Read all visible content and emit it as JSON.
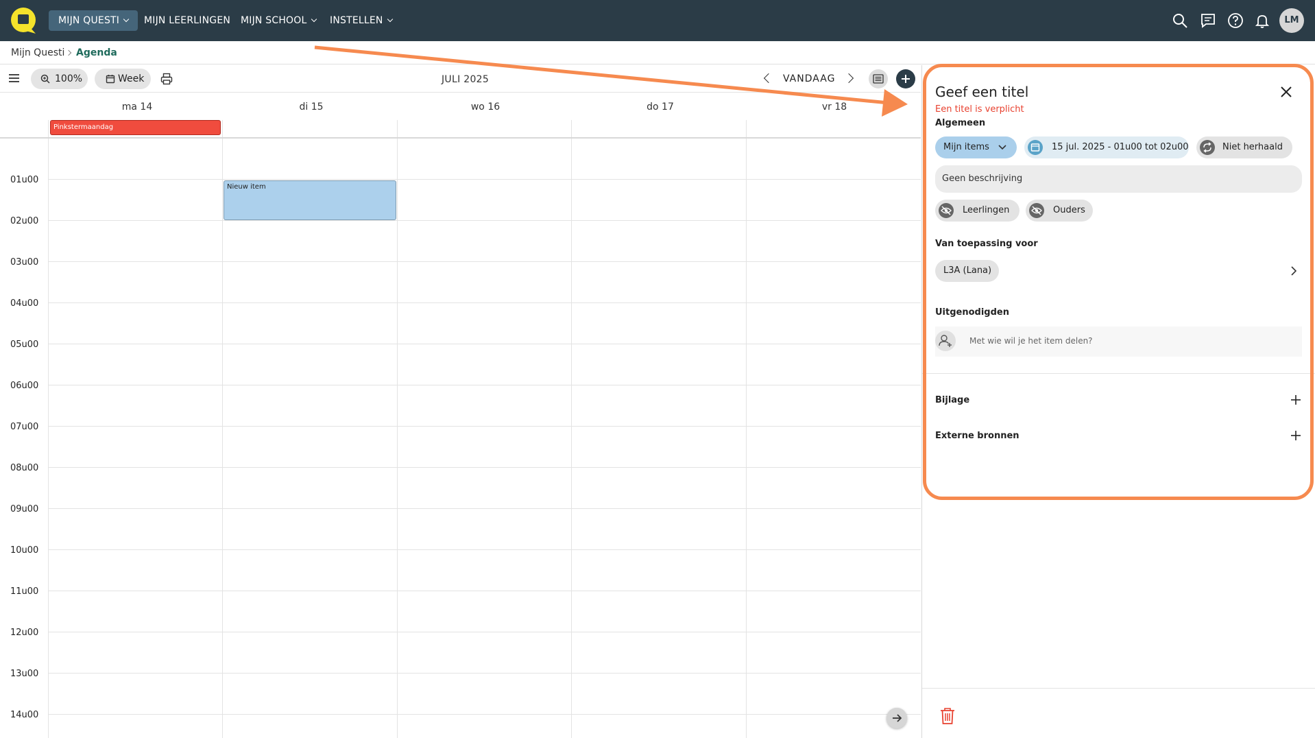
{
  "app": {
    "logo_icon": "questi-chat-logo-icon",
    "brand_color": "#f5e32b",
    "topbar_color": "#2b3c47"
  },
  "nav": {
    "items": [
      {
        "label": "MIJN QUESTI",
        "active": true,
        "dropdown": true
      },
      {
        "label": "MIJN LEERLINGEN",
        "active": false,
        "dropdown": false
      },
      {
        "label": "MIJN SCHOOL",
        "active": false,
        "dropdown": true
      },
      {
        "label": "INSTELLEN",
        "active": false,
        "dropdown": true
      }
    ],
    "icons": [
      "search-icon",
      "message-icon",
      "help-icon",
      "bell-icon"
    ],
    "avatar_initials": "LM"
  },
  "breadcrumb": {
    "home": "Mijn Questi",
    "current": "Agenda"
  },
  "toolbar": {
    "zoom": "100%",
    "view": "Week",
    "month": "JULI 2025",
    "today": "VANDAAG"
  },
  "calendar": {
    "days": [
      "ma 14",
      "di 15",
      "wo 16",
      "do 17",
      "vr 18"
    ],
    "holiday": "Pinkstermaandag",
    "hours": [
      "01u00",
      "02u00",
      "03u00",
      "04u00",
      "05u00",
      "06u00",
      "07u00",
      "08u00",
      "09u00",
      "10u00",
      "11u00",
      "12u00",
      "13u00",
      "14u00"
    ],
    "event": {
      "title": "Nieuw item",
      "color": "#acd0ec"
    },
    "holiday_color": "#f04c3e"
  },
  "panel": {
    "title": "Geef een titel",
    "error": "Een titel is verplicht",
    "error_color": "#e8412f",
    "section_general": "Algemeen",
    "calendar_chip": "Mijn items",
    "date_chip": "15 jul. 2025 - 01u00 tot 02u00",
    "repeat_chip": "Niet herhaald",
    "description": "Geen beschrijving",
    "visibility": [
      "Leerlingen",
      "Ouders"
    ],
    "section_applies": "Van toepassing voor",
    "applies_value": "L3A (Lana)",
    "section_invited": "Uitgenodigden",
    "invite_placeholder": "Met wie wil je het item delen?",
    "attachment": "Bijlage",
    "external": "Externe bronnen",
    "highlight_color": "#f68a4f",
    "delete_color": "#e8412f"
  }
}
